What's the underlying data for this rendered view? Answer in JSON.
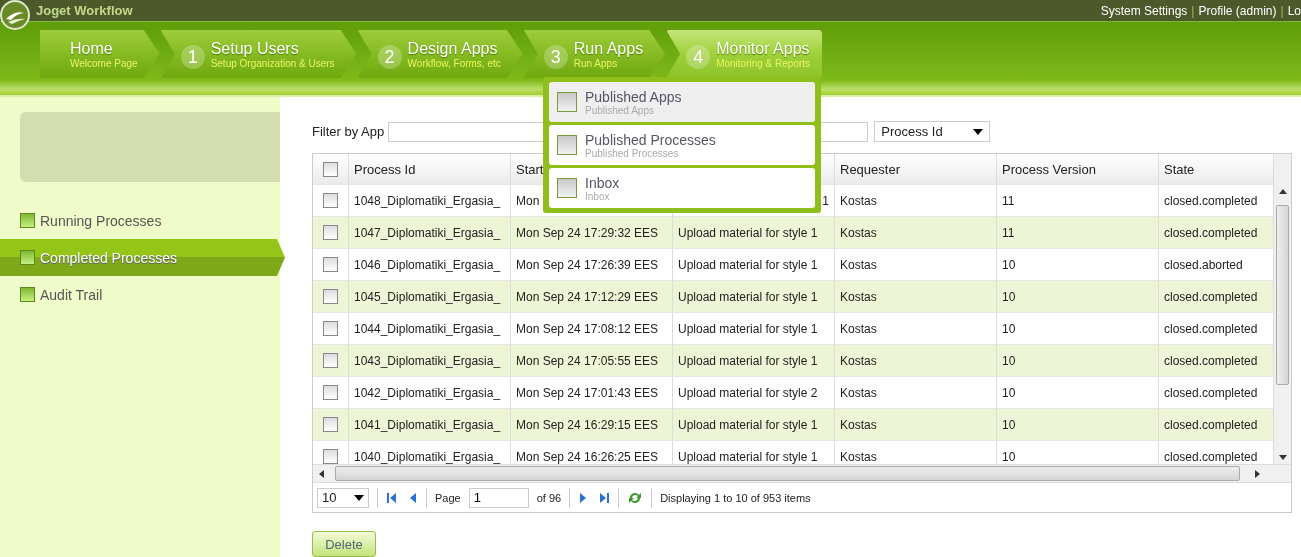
{
  "top_bar": {
    "title": "Joget Workflow",
    "separator": "|",
    "links": [
      "System Settings",
      "Profile (admin)",
      "Lo"
    ]
  },
  "nav": [
    {
      "title": "Home",
      "subtitle": "Welcome Page",
      "selected": false
    },
    {
      "number": "1",
      "title": "Setup Users",
      "subtitle": "Setup Organization & Users",
      "selected": false
    },
    {
      "number": "2",
      "title": "Design Apps",
      "subtitle": "Workflow, Forms, etc",
      "selected": false
    },
    {
      "number": "3",
      "title": "Run Apps",
      "subtitle": "Run Apps",
      "selected": false
    },
    {
      "number": "4",
      "title": "Monitor Apps",
      "subtitle": "Monitoring & Reports",
      "selected": true
    }
  ],
  "menu": [
    {
      "title": "Published Apps",
      "subtitle": "Published Apps",
      "highlighted": true
    },
    {
      "title": "Published Processes",
      "subtitle": "Published Processes",
      "highlighted": false
    },
    {
      "title": "Inbox",
      "subtitle": "Inbox",
      "highlighted": false
    }
  ],
  "sidebar": {
    "items": [
      {
        "label": "Running Processes",
        "selected": false
      },
      {
        "label": "Completed Processes",
        "selected": true
      },
      {
        "label": "Audit Trail",
        "selected": false
      }
    ]
  },
  "filter": {
    "label": "Filter by App",
    "select": "Process Id"
  },
  "table": {
    "header_checked": false,
    "columns": [
      "Process Id",
      "Start",
      null,
      "Requester",
      "Process Version",
      "State"
    ],
    "rows": [
      {
        "checked": false,
        "under_menu": true,
        "cells": [
          "1048_Diplomatiki_Ergasia_",
          "Mon",
          "1",
          "Kostas",
          "11",
          "closed.completed"
        ]
      },
      {
        "checked": false,
        "cells": [
          "1047_Diplomatiki_Ergasia_",
          "Mon Sep 24 17:29:32 EES",
          "Upload material for style 1",
          "Kostas",
          "11",
          "closed.completed"
        ]
      },
      {
        "checked": false,
        "cells": [
          "1046_Diplomatiki_Ergasia_",
          "Mon Sep 24 17:26:39 EES",
          "Upload material for style 1",
          "Kostas",
          "10",
          "closed.aborted"
        ]
      },
      {
        "checked": false,
        "cells": [
          "1045_Diplomatiki_Ergasia_",
          "Mon Sep 24 17:12:29 EES",
          "Upload material for style 1",
          "Kostas",
          "10",
          "closed.completed"
        ]
      },
      {
        "checked": false,
        "cells": [
          "1044_Diplomatiki_Ergasia_",
          "Mon Sep 24 17:08:12 EES",
          "Upload material for style 1",
          "Kostas",
          "10",
          "closed.completed"
        ]
      },
      {
        "checked": false,
        "cells": [
          "1043_Diplomatiki_Ergasia_",
          "Mon Sep 24 17:05:55 EES",
          "Upload material for style 1",
          "Kostas",
          "10",
          "closed.completed"
        ]
      },
      {
        "checked": false,
        "cells": [
          "1042_Diplomatiki_Ergasia_",
          "Mon Sep 24 17:01:43 EES",
          "Upload material for style 2",
          "Kostas",
          "10",
          "closed.completed"
        ]
      },
      {
        "checked": false,
        "cells": [
          "1041_Diplomatiki_Ergasia_",
          "Mon Sep 24 16:29:15 EES",
          "Upload material for style 1",
          "Kostas",
          "10",
          "closed.completed"
        ]
      },
      {
        "checked": false,
        "cells": [
          "1040_Diplomatiki_Ergasia_",
          "Mon Sep 24 16:26:25 EES",
          "Upload material for style 1",
          "Kostas",
          "10",
          "closed.completed"
        ]
      }
    ]
  },
  "pager": {
    "page_size": "10",
    "page_label": "Page",
    "page": "1",
    "of": "of 96",
    "status": "Displaying 1 to 10 of 953 items"
  },
  "buttons": [
    "Delete"
  ]
}
